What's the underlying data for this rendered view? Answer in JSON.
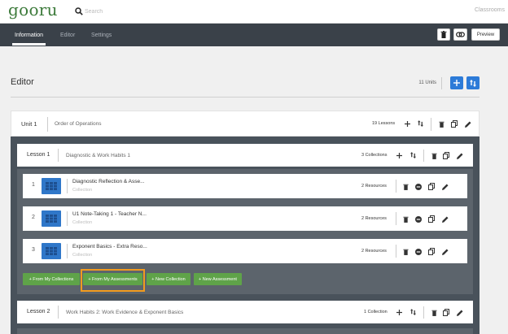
{
  "app": {
    "logo": "gooru"
  },
  "search": {
    "placeholder": "Search"
  },
  "topnav": {
    "classrooms": "Classrooms"
  },
  "tabs": [
    {
      "label": "Information",
      "active": true
    },
    {
      "label": "Editor",
      "active": false
    },
    {
      "label": "Settings",
      "active": false
    }
  ],
  "toolbar": {
    "preview_label": "Preview"
  },
  "editor": {
    "title": "Editor",
    "units_count": "11 Units"
  },
  "unit": {
    "label": "Unit 1",
    "title": "Order of Operations",
    "lessons_count": "19 Lessons"
  },
  "lesson1": {
    "label": "Lesson 1",
    "title": "Diagnostic & Work Habits 1",
    "collections_count": "3 Collections"
  },
  "collections": [
    {
      "num": "1",
      "title": "Diagnostic Reflection & Asse...",
      "type": "Collection",
      "resources": "2 Resources"
    },
    {
      "num": "2",
      "title": "U1 Note-Taking 1 - Teacher N...",
      "type": "Collection",
      "resources": "2 Resources"
    },
    {
      "num": "3",
      "title": "Exponent Basics - Extra Reso...",
      "type": "Collection",
      "resources": "2 Resources"
    }
  ],
  "actions": {
    "from_collections": "+ From My Collections",
    "from_assessments": "+ From My Assessments",
    "new_collection": "+ New Collection",
    "new_assessment": "+ New Assessment"
  },
  "lesson2": {
    "label": "Lesson 2",
    "title": "Work Habits 2: Work Evidence & Exponent Basics",
    "collections_count": "1 Collection"
  },
  "colors": {
    "brand": "#3c7a3a",
    "accent": "#2d7bd8",
    "green": "#5fa349",
    "highlight": "#f29b1e",
    "dark": "#3a4149"
  }
}
